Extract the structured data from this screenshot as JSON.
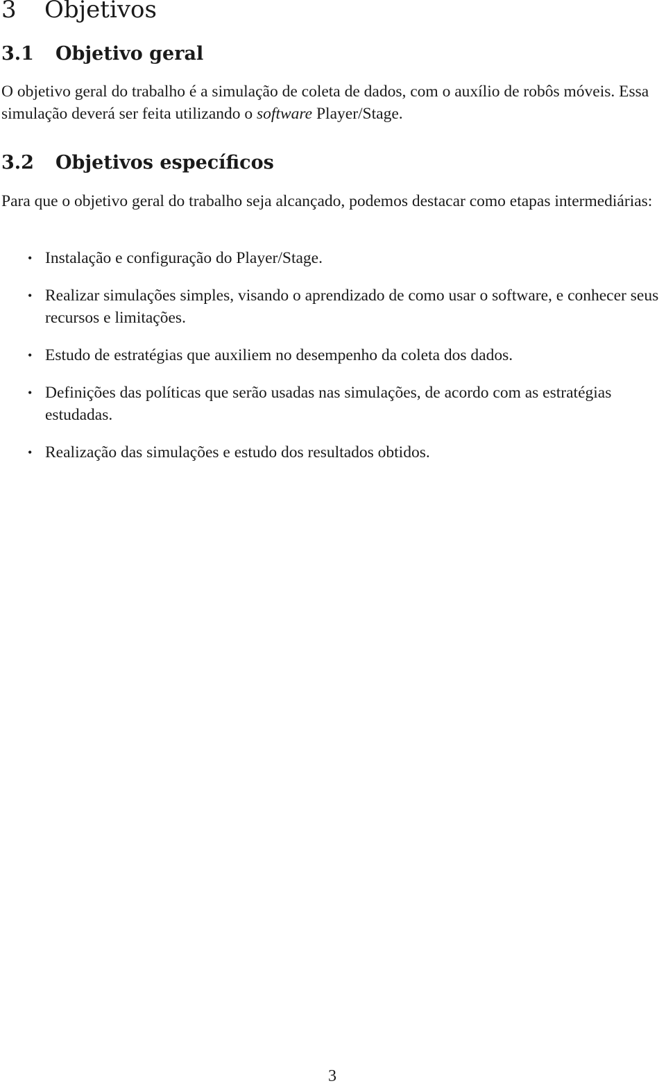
{
  "section": {
    "number": "3",
    "title": "Objetivos"
  },
  "subsection_1": {
    "number": "3.1",
    "title": "Objetivo geral",
    "paragraph_before_em": "O objetivo geral do trabalho é a simulação de coleta de dados, com o auxílio de robôs móveis. Essa simulação deverá ser feita utilizando o ",
    "paragraph_em": "software",
    "paragraph_after_em": " Player/Stage."
  },
  "subsection_2": {
    "number": "3.2",
    "title": "Objetivos específicos",
    "paragraph": "Para que o objetivo geral do trabalho seja alcançado, podemos destacar como etapas intermediárias:",
    "items": [
      "Instalação e configuração do Player/Stage.",
      "Realizar simulações simples, visando o aprendizado de como usar o software, e conhecer seus recursos e limitações.",
      "Estudo de estratégias que auxiliem no desempenho da coleta dos dados.",
      "Definições das políticas que serão usadas nas simulações, de acordo com as estratégias estudadas.",
      "Realização das simulações e estudo dos resultados obtidos."
    ],
    "bullet_glyph": "•"
  },
  "footer": {
    "page_number": "3"
  }
}
